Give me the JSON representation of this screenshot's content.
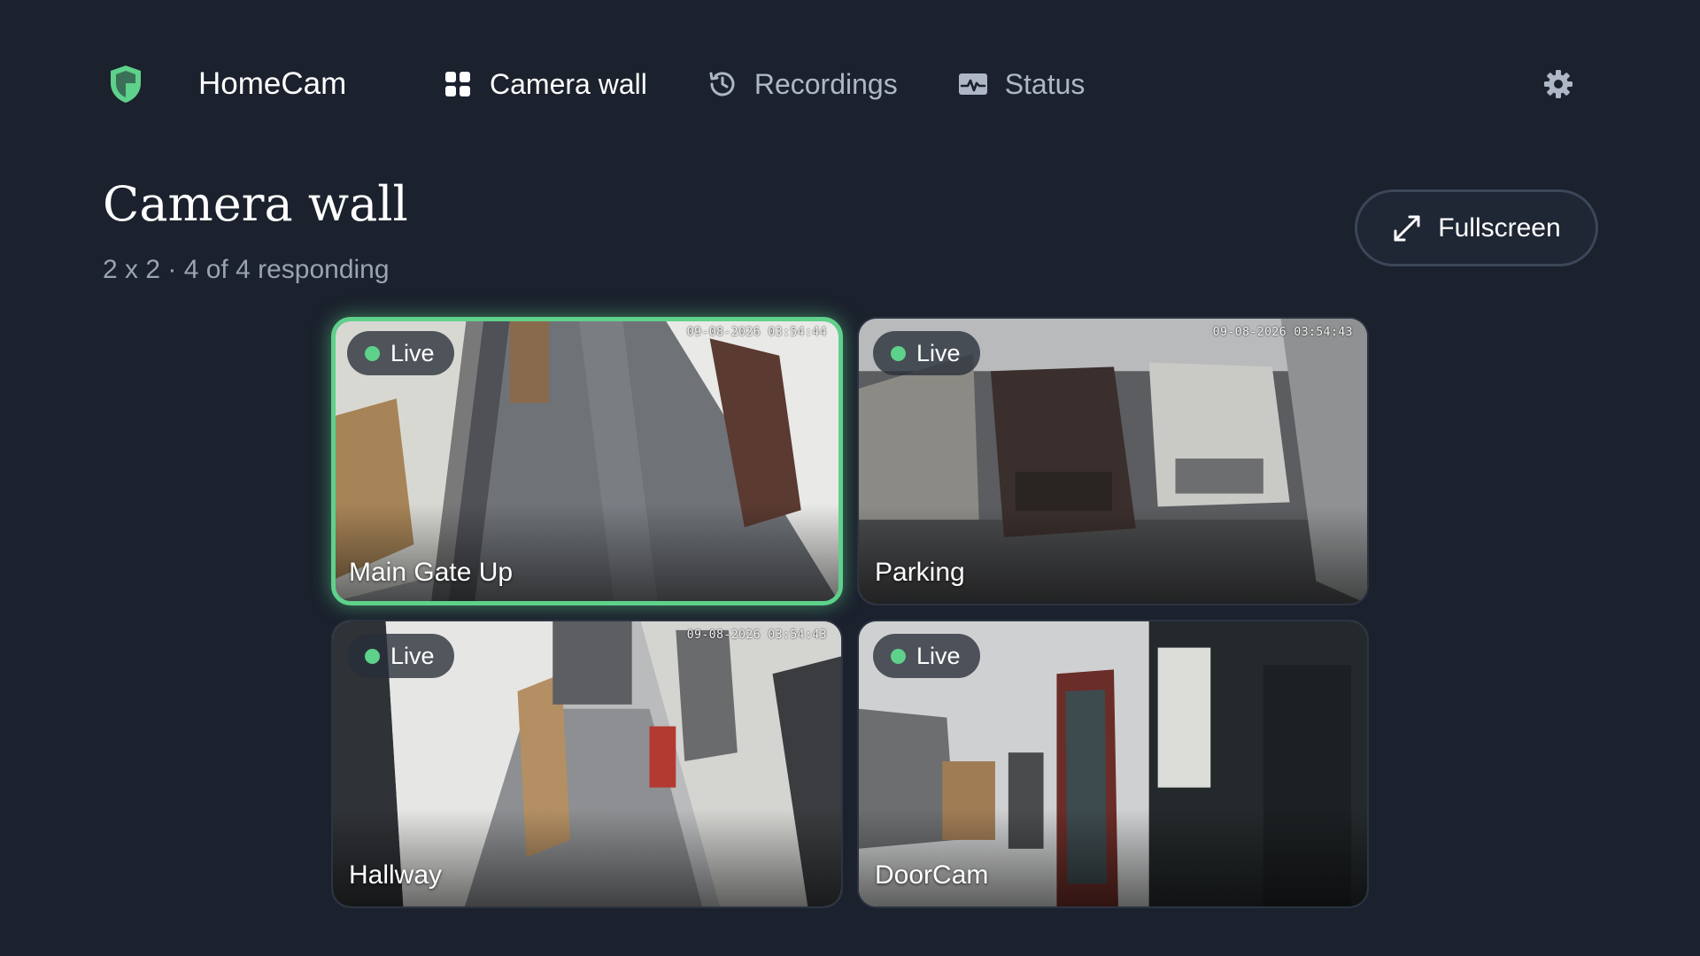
{
  "app": {
    "name": "HomeCam",
    "accent_color": "#5ed18a",
    "logo_icon": "shield-icon"
  },
  "nav": {
    "items": [
      {
        "label": "Camera wall",
        "icon": "grid-icon",
        "active": true
      },
      {
        "label": "Recordings",
        "icon": "history-icon",
        "active": false
      },
      {
        "label": "Status",
        "icon": "activity-icon",
        "active": false
      }
    ],
    "settings_icon": "gear-icon"
  },
  "page": {
    "title": "Camera wall",
    "subtitle": "2 x 2 · 4 of 4 responding",
    "fullscreen_label": "Fullscreen"
  },
  "cameras": [
    {
      "name": "Main Gate Up",
      "status": "Live",
      "timestamp": "09-08-2026 03:54:44",
      "selected": true
    },
    {
      "name": "Parking",
      "status": "Live",
      "timestamp": "09-08-2026 03:54:43",
      "selected": false
    },
    {
      "name": "Hallway",
      "status": "Live",
      "timestamp": "09-08-2026 03:54:43",
      "selected": false
    },
    {
      "name": "DoorCam",
      "status": "Live",
      "timestamp": "",
      "selected": false
    }
  ]
}
